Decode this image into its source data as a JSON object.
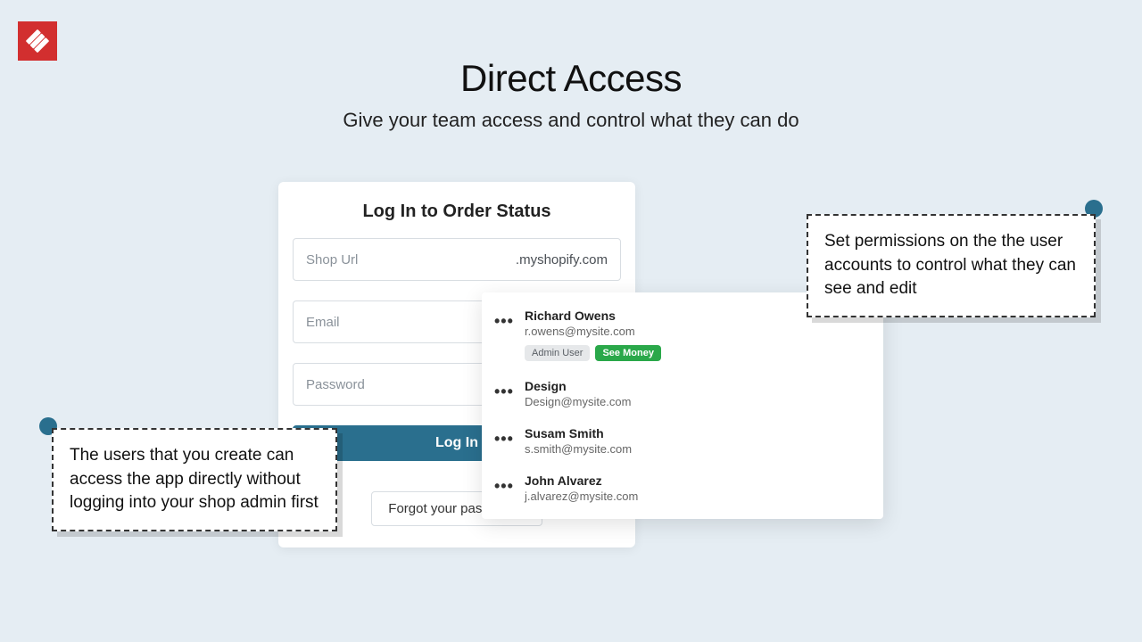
{
  "headline": {
    "title": "Direct Access",
    "subtitle": "Give your team access and control what they can do"
  },
  "login": {
    "title": "Log In to Order Status",
    "shop_label": "Shop Url",
    "shop_suffix": ".myshopify.com",
    "email_label": "Email",
    "password_label": "Password",
    "login_button": "Log In",
    "forgot_button": "Forgot your password?"
  },
  "users": [
    {
      "name": "Richard Owens",
      "email": "r.owens@mysite.com",
      "badges": [
        {
          "label": "Admin User",
          "kind": "gray"
        },
        {
          "label": "See Money",
          "kind": "green"
        }
      ]
    },
    {
      "name": "Design",
      "email": "Design@mysite.com",
      "badges": []
    },
    {
      "name": "Susam Smith",
      "email": "s.smith@mysite.com",
      "badges": []
    },
    {
      "name": "John Alvarez",
      "email": "j.alvarez@mysite.com",
      "badges": []
    }
  ],
  "callouts": {
    "left": "The users that you create can access the app directly without logging into your shop admin first",
    "right": "Set permissions on the the user accounts to control what they can see and edit"
  },
  "colors": {
    "accent": "#2a6f8e",
    "logo_bg": "#d22f2f",
    "badge_green": "#2aa84a"
  }
}
